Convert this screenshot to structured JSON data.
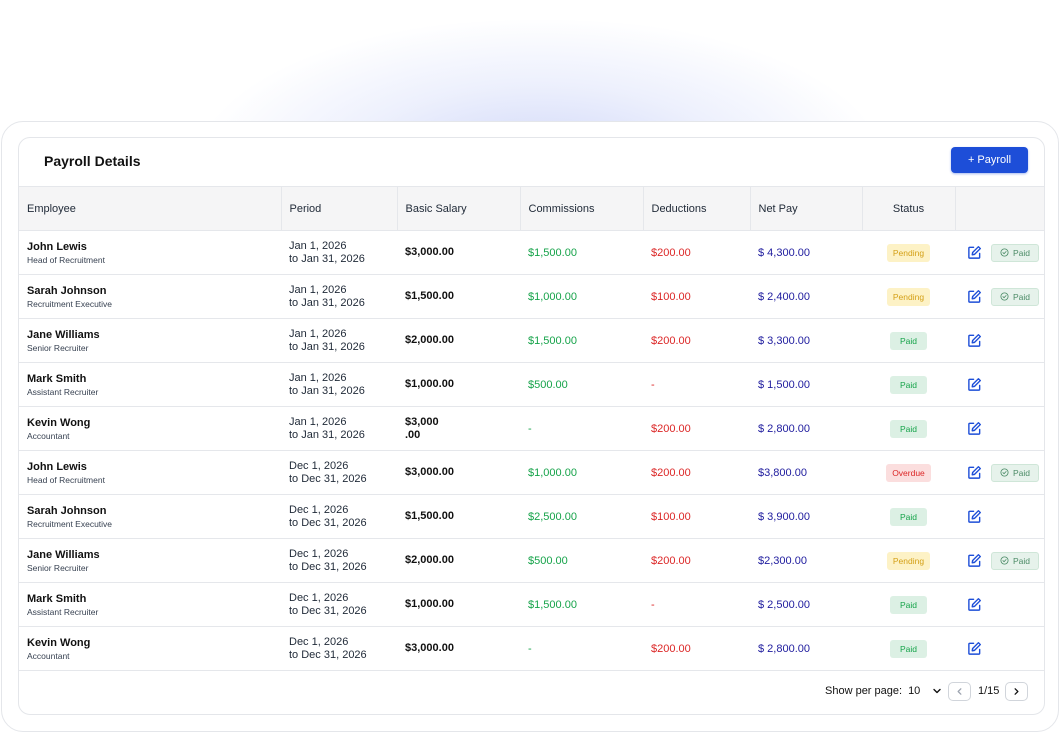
{
  "header": {
    "title": "Payroll Details",
    "add_button": "+ Payroll"
  },
  "columns": [
    "Employee",
    "Period",
    "Basic Salary",
    "Commissions",
    "Deductions",
    "Net Pay",
    "Status",
    ""
  ],
  "rows": [
    {
      "name": "John Lewis",
      "role": "Head of Recruitment",
      "period_start": "Jan 1, 2026",
      "period_end": "to Jan 31, 2026",
      "basic": "$3,000.00",
      "commission": "$1,500.00",
      "deduction": "$200.00",
      "net": "$ 4,300.00",
      "status": "Pending",
      "mark_paid": "Paid"
    },
    {
      "name": "Sarah Johnson",
      "role": "Recruitment Executive",
      "period_start": "Jan 1, 2026",
      "period_end": "to Jan 31, 2026",
      "basic": "$1,500.00",
      "commission": "$1,000.00",
      "deduction": "$100.00",
      "net": "$ 2,400.00",
      "status": "Pending",
      "mark_paid": "Paid"
    },
    {
      "name": "Jane Williams",
      "role": "Senior Recruiter",
      "period_start": "Jan 1, 2026",
      "period_end": "to Jan 31, 2026",
      "basic": "$2,000.00",
      "commission": "$1,500.00",
      "deduction": "$200.00",
      "net": "$ 3,300.00",
      "status": "Paid",
      "mark_paid": ""
    },
    {
      "name": "Mark Smith",
      "role": "Assistant Recruiter",
      "period_start": "Jan 1, 2026",
      "period_end": "to Jan 31, 2026",
      "basic": "$1,000.00",
      "commission": "$500.00",
      "deduction": "-",
      "net": "$ 1,500.00",
      "status": "Paid",
      "mark_paid": ""
    },
    {
      "name": "Kevin Wong",
      "role": "Accountant",
      "period_start": "Jan 1, 2026",
      "period_end": "to Jan 31, 2026",
      "basic": "$3,000\n.00",
      "commission": "-",
      "deduction": "$200.00",
      "net": "$ 2,800.00",
      "status": "Paid",
      "mark_paid": ""
    },
    {
      "name": "John Lewis",
      "role": "Head of Recruitment",
      "period_start": "Dec 1, 2026",
      "period_end": "to Dec 31, 2026",
      "basic": "$3,000.00",
      "commission": "$1,000.00",
      "deduction": "$200.00",
      "net": "$3,800.00",
      "status": "Overdue",
      "mark_paid": "Paid"
    },
    {
      "name": "Sarah Johnson",
      "role": "Recruitment Executive",
      "period_start": "Dec 1, 2026",
      "period_end": "to Dec 31, 2026",
      "basic": "$1,500.00",
      "commission": "$2,500.00",
      "deduction": "$100.00",
      "net": "$ 3,900.00",
      "status": "Paid",
      "mark_paid": ""
    },
    {
      "name": "Jane Williams",
      "role": "Senior Recruiter",
      "period_start": "Dec 1, 2026",
      "period_end": "to Dec 31, 2026",
      "basic": "$2,000.00",
      "commission": "$500.00",
      "deduction": "$200.00",
      "net": "$2,300.00",
      "status": "Pending",
      "mark_paid": "Paid"
    },
    {
      "name": "Mark Smith",
      "role": "Assistant Recruiter",
      "period_start": "Dec 1, 2026",
      "period_end": "to Dec 31, 2026",
      "basic": "$1,000.00",
      "commission": "$1,500.00",
      "deduction": "-",
      "net": "$ 2,500.00",
      "status": "Paid",
      "mark_paid": ""
    },
    {
      "name": "Kevin Wong",
      "role": "Accountant",
      "period_start": "Dec 1, 2026",
      "period_end": "to Dec 31, 2026",
      "basic": "$3,000.00",
      "commission": "-",
      "deduction": "$200.00",
      "net": "$ 2,800.00",
      "status": "Paid",
      "mark_paid": ""
    }
  ],
  "pagination": {
    "per_page_label": "Show per page:",
    "per_page_value": "10",
    "page_text": "1/15"
  },
  "icons": {
    "edit": "edit-icon",
    "check": "check-circle-icon",
    "prev": "chevron-left-icon",
    "next": "chevron-right-icon",
    "dropdown": "chevron-down-icon"
  },
  "colors": {
    "accent": "#1d4ed8",
    "commission": "#16a34a",
    "deduction": "#dc2626",
    "net": "#1e1b9e",
    "paid_bg": "#dcf0e4",
    "pending_bg": "#fdf2c6",
    "overdue_bg": "#fbdede"
  }
}
